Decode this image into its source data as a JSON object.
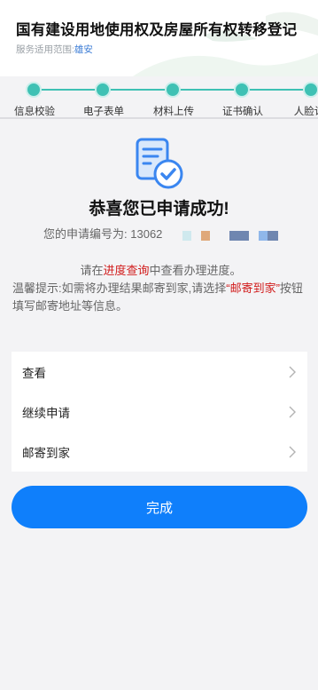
{
  "header": {
    "title": "国有建设用地使用权及房屋所有权转移登记",
    "scope_label": "服务适用范围:",
    "scope_value": "雄安"
  },
  "steps": [
    {
      "label": "信息校验"
    },
    {
      "label": "电子表单"
    },
    {
      "label": "材料上传"
    },
    {
      "label": "证书确认"
    },
    {
      "label": "人脸认"
    }
  ],
  "result": {
    "headline": "恭喜您已申请成功!",
    "application_no_label": "您的申请编号为:",
    "application_no_visible": "13062"
  },
  "notice": {
    "line1_pre": "请在",
    "line1_link": "进度查询",
    "line1_post": "中查看办理进度。",
    "line2_pre": "温馨提示:如需将办理结果邮寄到家,请选择",
    "line2_highlight": "“邮寄到家”",
    "line2_post": "按钮填写邮寄地址等信息。"
  },
  "menu": [
    {
      "label": "查看"
    },
    {
      "label": "继续申请"
    },
    {
      "label": "邮寄到家"
    }
  ],
  "finish_label": "完成",
  "colors": {
    "accent": "#0f7ffb",
    "step": "#3fc1b4",
    "highlight": "#d11b1b"
  }
}
